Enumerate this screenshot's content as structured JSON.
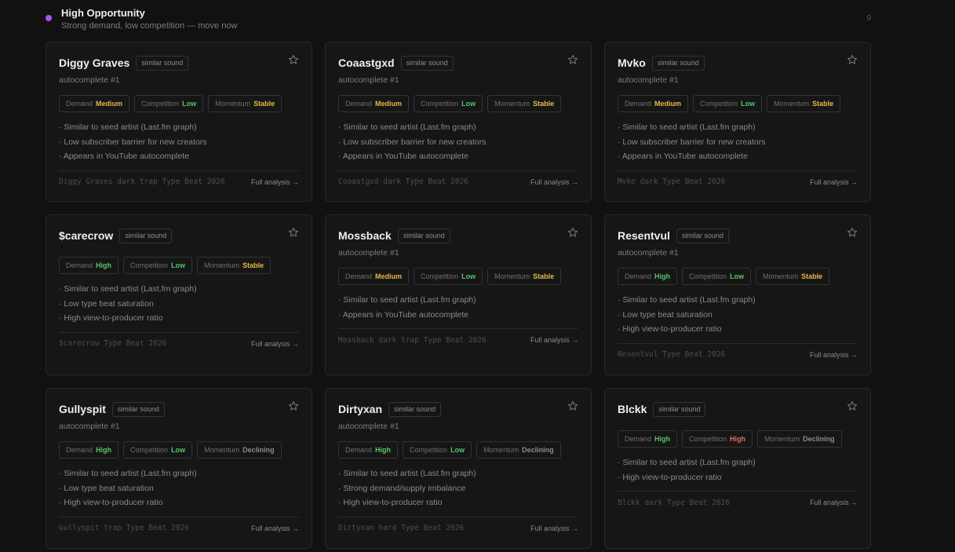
{
  "section": {
    "title": "High Opportunity",
    "subtitle": "Strong demand, low competition — move now",
    "count": "9",
    "accent_color": "#a855f7"
  },
  "labels": {
    "demand": "Demand",
    "competition": "Competition",
    "momentum": "Momentum",
    "full_analysis": "Full analysis →"
  },
  "level_colors": {
    "Medium": "#e6b84a",
    "High": "#58c46a",
    "Low": "#58c46a",
    "Stable": "#e6b84a",
    "Declining": "#8c8c8c",
    "High-competition": "#e76a6a"
  },
  "cards": [
    {
      "name": "Diggy Graves",
      "tag": "similar sound",
      "sub": "autocomplete #1",
      "demand": "Medium",
      "competition": "Low",
      "momentum": "Stable",
      "reasons": [
        "· Similar to seed artist (Last.fm graph)",
        "· Low subscriber barrier for new creators",
        "· Appears in YouTube autocomplete"
      ],
      "query": "Diggy Graves dark trap Type Beat 2026"
    },
    {
      "name": "Coaastgxd",
      "tag": "similar sound",
      "sub": "autocomplete #1",
      "demand": "Medium",
      "competition": "Low",
      "momentum": "Stable",
      "reasons": [
        "· Similar to seed artist (Last.fm graph)",
        "· Low subscriber barrier for new creators",
        "· Appears in YouTube autocomplete"
      ],
      "query": "Coaastgxd dark Type Beat 2026"
    },
    {
      "name": "Mvko",
      "tag": "similar sound",
      "sub": "autocomplete #1",
      "demand": "Medium",
      "competition": "Low",
      "momentum": "Stable",
      "reasons": [
        "· Similar to seed artist (Last.fm graph)",
        "· Low subscriber barrier for new creators",
        "· Appears in YouTube autocomplete"
      ],
      "query": "Mvko dark Type Beat 2026"
    },
    {
      "name": "$carecrow",
      "tag": "similar sound",
      "sub": "",
      "demand": "High",
      "competition": "Low",
      "momentum": "Stable",
      "reasons": [
        "· Similar to seed artist (Last.fm graph)",
        "· Low type beat saturation",
        "· High view-to-producer ratio"
      ],
      "query": "$carecrow Type Beat 2026"
    },
    {
      "name": "Mossback",
      "tag": "similar sound",
      "sub": "autocomplete #1",
      "demand": "Medium",
      "competition": "Low",
      "momentum": "Stable",
      "reasons": [
        "· Similar to seed artist (Last.fm graph)",
        "· Appears in YouTube autocomplete"
      ],
      "query": "Mossback dark trap Type Beat 2026"
    },
    {
      "name": "Resentvul",
      "tag": "similar sound",
      "sub": "autocomplete #1",
      "demand": "High",
      "competition": "Low",
      "momentum": "Stable",
      "reasons": [
        "· Similar to seed artist (Last.fm graph)",
        "· Low type beat saturation",
        "· High view-to-producer ratio"
      ],
      "query": "Resentvul Type Beat 2026"
    },
    {
      "name": "Gullyspit",
      "tag": "similar sound",
      "sub": "autocomplete #1",
      "demand": "High",
      "competition": "Low",
      "momentum": "Declining",
      "reasons": [
        "· Similar to seed artist (Last.fm graph)",
        "· Low type beat saturation",
        "· High view-to-producer ratio"
      ],
      "query": "Gullyspit trap Type Beat 2026"
    },
    {
      "name": "Dirtyxan",
      "tag": "similar sound",
      "sub": "autocomplete #1",
      "demand": "High",
      "competition": "Low",
      "momentum": "Declining",
      "reasons": [
        "· Similar to seed artist (Last.fm graph)",
        "· Strong demand/supply imbalance",
        "· High view-to-producer ratio"
      ],
      "query": "Dirtyxan hard Type Beat 2026"
    },
    {
      "name": "Blckk",
      "tag": "similar sound",
      "sub": "",
      "demand": "High",
      "competition": "High",
      "momentum": "Declining",
      "reasons": [
        "· Similar to seed artist (Last.fm graph)",
        "· High view-to-producer ratio"
      ],
      "query": "Blckk dark Type Beat 2026"
    }
  ]
}
